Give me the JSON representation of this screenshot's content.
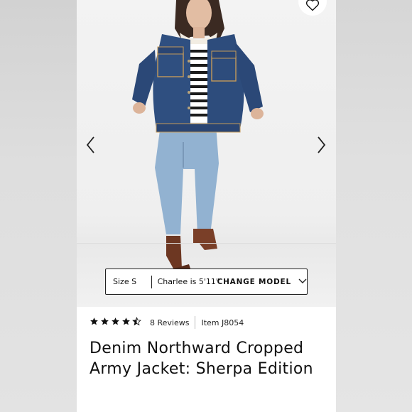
{
  "product": {
    "title": "Denim Northward Cropped Army Jacket: Sherpa Edition",
    "rating": 4.5,
    "reviews_label": "8 Reviews",
    "item_label": "Item J8054"
  },
  "size_bar": {
    "size_label": "Size S",
    "model_label": "Charlee is 5'11\"",
    "change_label": "CHANGE MODEL"
  },
  "icons": {
    "favorite": "heart-icon",
    "prev": "chevron-left-icon",
    "next": "chevron-right-icon",
    "dropdown": "chevron-down-icon",
    "star": "star-icon"
  },
  "colors": {
    "denim_jacket": "#2f4f80",
    "jeans": "#8fb0d0",
    "boots": "#7a3f28"
  }
}
